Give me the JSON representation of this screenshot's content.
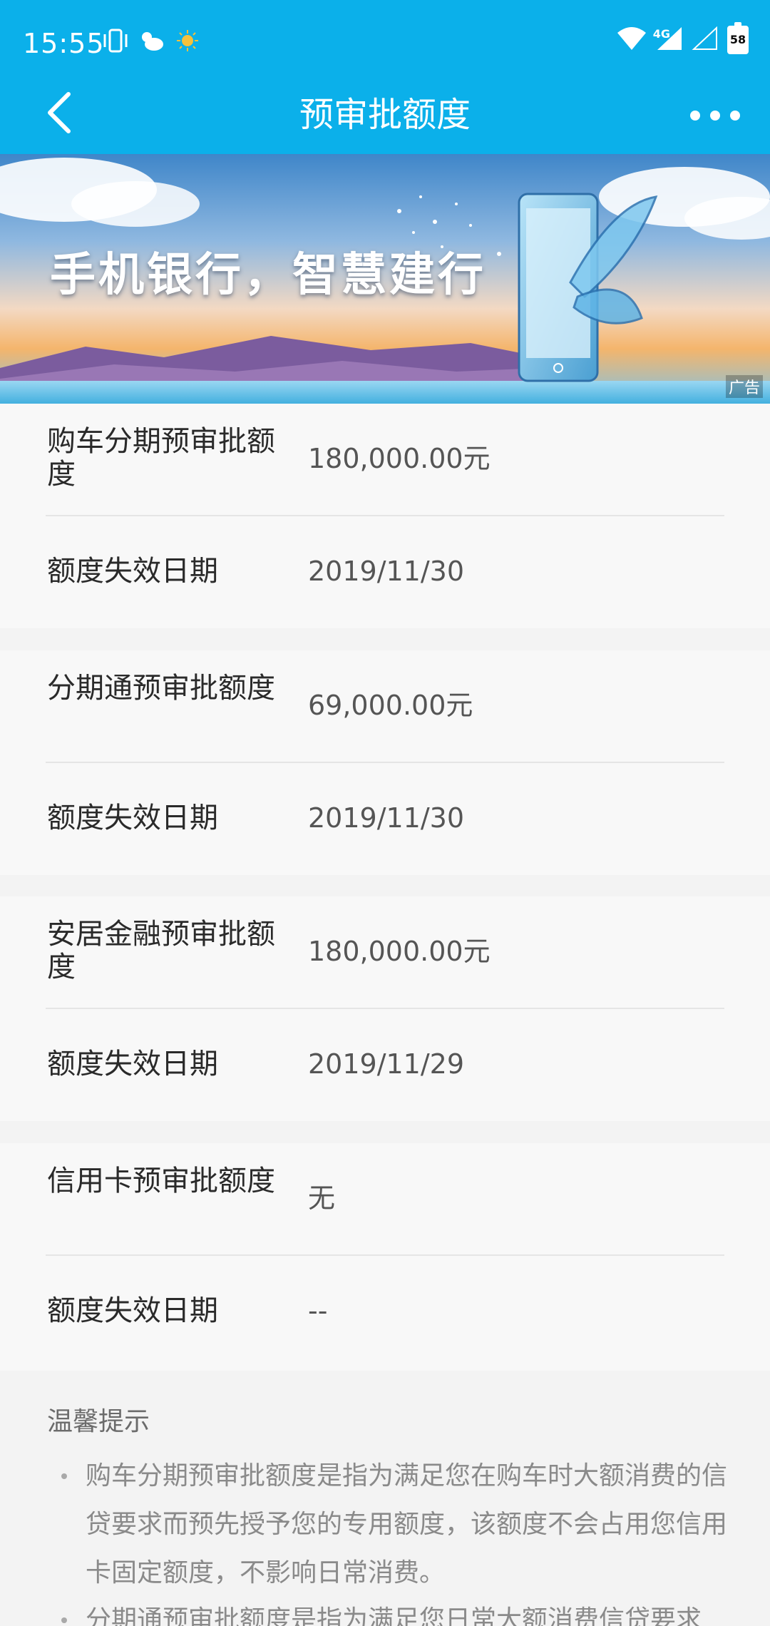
{
  "status_bar": {
    "time": "15:55",
    "network": "4G",
    "battery": "58"
  },
  "nav": {
    "title": "预审批额度"
  },
  "banner": {
    "slogan": "手机银行，智慧建行",
    "ad_tag": "广告"
  },
  "cards": [
    {
      "rows": [
        {
          "label": "购车分期预审批额度",
          "value": "180,000.00元"
        },
        {
          "label": "额度失效日期",
          "value": "2019/11/30"
        }
      ]
    },
    {
      "rows": [
        {
          "label": "分期通预审批额度",
          "value": "69,000.00元"
        },
        {
          "label": "额度失效日期",
          "value": "2019/11/30"
        }
      ]
    },
    {
      "rows": [
        {
          "label": "安居金融预审批额度",
          "value": "180,000.00元"
        },
        {
          "label": "额度失效日期",
          "value": "2019/11/29"
        }
      ]
    },
    {
      "rows": [
        {
          "label": "信用卡预审批额度",
          "value": "无"
        },
        {
          "label": "额度失效日期",
          "value": "--"
        }
      ]
    }
  ],
  "tips": {
    "title": "温馨提示",
    "items": [
      "购车分期预审批额度是指为满足您在购车时大额消费的信贷要求而预先授予您的专用额度，该额度不会占用您信用卡固定额度，不影响日常消费。",
      "分期通预审批额度是指为满足您日常大额消费信贷要求"
    ]
  },
  "colors": {
    "brand": "#0bb0ea",
    "card_bg": "#f8f8f8",
    "page_bg": "#f3f3f3"
  }
}
